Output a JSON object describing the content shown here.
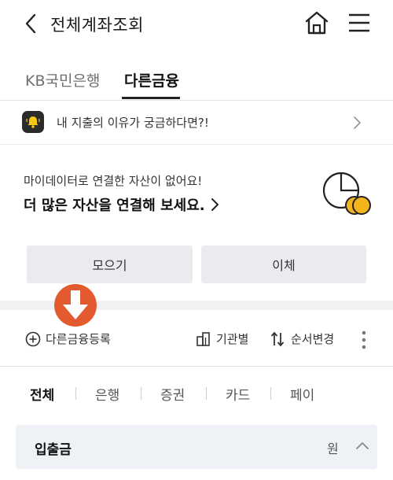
{
  "header": {
    "title": "전체계좌조회",
    "icons": {
      "back": "chevron-left-icon",
      "home": "home-icon",
      "menu": "hamburger-menu-icon"
    }
  },
  "tabs": [
    {
      "label": "KB국민은행",
      "active": false
    },
    {
      "label": "다른금융",
      "active": true
    }
  ],
  "notice": {
    "text": "내 지출의 이유가 궁금하다면?!",
    "icon": "bell-icon"
  },
  "mydata": {
    "subtitle": "마이데이터로 연결한 자산이 없어요!",
    "cta": "더 많은 자산을 연결해 보세요.",
    "icon": "pie-coins-icon"
  },
  "buttons": {
    "collect": "모으기",
    "transfer": "이체"
  },
  "actions": {
    "register": "다른금융등록",
    "by_institution": "기관별",
    "reorder": "순서변경"
  },
  "filters": [
    {
      "label": "전체",
      "active": true
    },
    {
      "label": "은행",
      "active": false
    },
    {
      "label": "증권",
      "active": false
    },
    {
      "label": "카드",
      "active": false
    },
    {
      "label": "페이",
      "active": false
    }
  ],
  "section": {
    "title": "입출금",
    "unit": "원",
    "expanded": true
  },
  "colors": {
    "accent_orange": "#e35a2e",
    "coin_yellow": "#f2b61c",
    "button_bg": "#e9ebee",
    "section_bg": "#eef2f7"
  }
}
